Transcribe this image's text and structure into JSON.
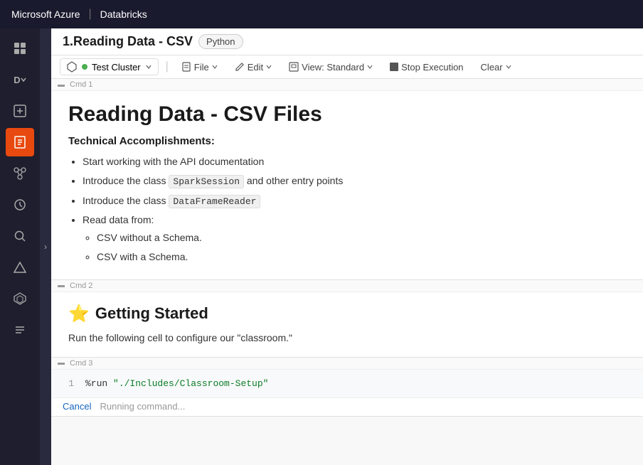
{
  "topnav": {
    "brand": "Microsoft Azure",
    "divider": "|",
    "product": "Databricks"
  },
  "sidebar": {
    "items": [
      {
        "name": "workspace-icon",
        "symbol": "⊞",
        "active": false
      },
      {
        "name": "data-icon",
        "symbol": "D▾",
        "active": false
      },
      {
        "name": "new-icon",
        "symbol": "+",
        "active": false
      },
      {
        "name": "notebook-icon",
        "symbol": "▦",
        "active": true
      },
      {
        "name": "jobs-icon",
        "symbol": "⎇",
        "active": false
      },
      {
        "name": "history-icon",
        "symbol": "⊙",
        "active": false
      },
      {
        "name": "search-icon",
        "symbol": "⌕",
        "active": false
      },
      {
        "name": "delta-icon",
        "symbol": "△",
        "active": false
      },
      {
        "name": "cluster-icon",
        "symbol": "⬡",
        "active": false
      },
      {
        "name": "list-icon",
        "symbol": "≡",
        "active": false
      }
    ],
    "expand_arrow": "›"
  },
  "notebook": {
    "title": "1.Reading Data - CSV",
    "language_badge": "Python",
    "cluster": {
      "name": "Test Cluster",
      "status_color": "#4caf50"
    },
    "toolbar_buttons": [
      {
        "label": "File",
        "icon": "📄",
        "name": "file-btn"
      },
      {
        "label": "Edit",
        "icon": "✎",
        "name": "edit-btn"
      },
      {
        "label": "View: Standard",
        "icon": "🖼",
        "name": "view-btn"
      },
      {
        "label": "Stop Execution",
        "icon": "□",
        "name": "stop-execution-btn"
      },
      {
        "label": "Clear",
        "icon": "▾",
        "name": "clear-btn"
      }
    ]
  },
  "cells": [
    {
      "id": "cmd-1",
      "cmd_label": "Cmd 1",
      "type": "markdown",
      "heading": "Reading Data - CSV Files",
      "content": {
        "section_title": "Technical Accomplishments:",
        "bullets": [
          {
            "text_before": "Start working with the API documentation",
            "inline_code": null
          },
          {
            "text_before": "Introduce the class ",
            "inline_code": "SparkSession",
            "text_after": " and other entry points"
          },
          {
            "text_before": "Introduce the class ",
            "inline_code": "DataFrameReader",
            "text_after": null
          },
          {
            "text_before": "Read data from:",
            "inline_code": null,
            "sub_bullets": [
              "CSV without a Schema.",
              "CSV with a Schema."
            ]
          }
        ]
      }
    },
    {
      "id": "cmd-2",
      "cmd_label": "Cmd 2",
      "type": "markdown",
      "heading": "Getting Started",
      "heading_icon": "⭐",
      "body_text": "Run the following cell to configure our \"classroom.\""
    },
    {
      "id": "cmd-3",
      "cmd_label": "Cmd 3",
      "type": "code",
      "lines": [
        {
          "num": 1,
          "code": "%run \"./Includes/Classroom-Setup\""
        }
      ],
      "footer": {
        "cancel_label": "Cancel",
        "status_label": "Running command..."
      }
    }
  ]
}
